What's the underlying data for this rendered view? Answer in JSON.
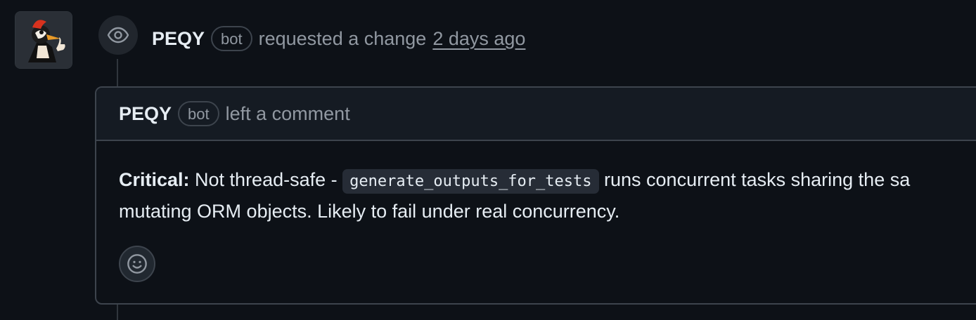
{
  "event": {
    "author": "PEQY",
    "bot_label": "bot",
    "action": "requested a change",
    "time": "2 days ago",
    "icon": "eye-icon"
  },
  "comment": {
    "author": "PEQY",
    "bot_label": "bot",
    "action": "left a comment",
    "body": {
      "strong": "Critical:",
      "text_before_code": " Not thread-safe - ",
      "code": "generate_outputs_for_tests",
      "text_after_code": " runs concurrent tasks sharing the sa",
      "line2": "mutating ORM objects. Likely to fail under real concurrency."
    },
    "reaction_icon": "smiley-icon"
  },
  "colors": {
    "background": "#0d1117",
    "border": "#3d444d",
    "muted_text": "#9198a1",
    "primary_text": "#e6edf3"
  }
}
